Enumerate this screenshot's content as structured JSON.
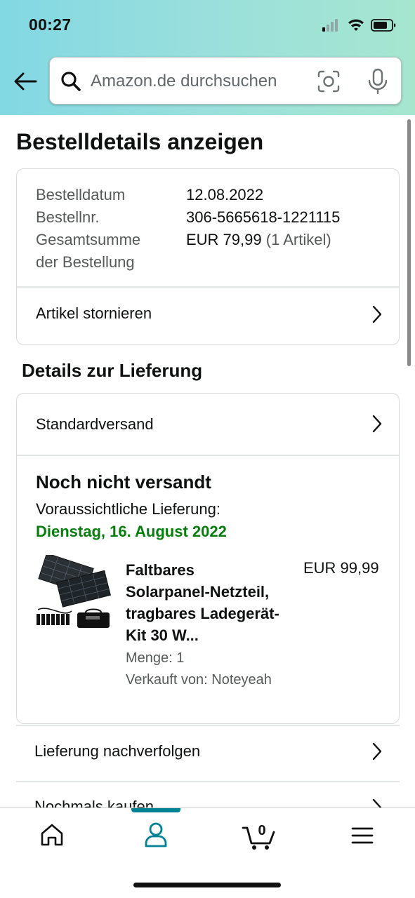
{
  "status_bar": {
    "time": "00:27"
  },
  "search": {
    "placeholder": "Amazon.de durchsuchen"
  },
  "page_title": "Bestelldetails anzeigen",
  "order": {
    "date_label": "Bestelldatum",
    "date_value": "12.08.2022",
    "number_label": "Bestellnr.",
    "number_value": "306-5665618-1221115",
    "total_label_line1": "Gesamtsumme",
    "total_label_line2": "der Bestellung",
    "total_value": "EUR 79,99",
    "total_items": "(1 Artikel)",
    "cancel_label": "Artikel stornieren"
  },
  "delivery": {
    "section_title": "Details zur Lieferung",
    "shipping_method": "Standardversand",
    "status": "Noch nicht versandt",
    "expected_label": "Voraussichtliche Lieferung:",
    "expected_date": "Dienstag, 16. August 2022",
    "product": {
      "title_lines": [
        "Faltbares",
        "Solarpanel-Netzteil,",
        "tragbares Ladegerät-",
        "Kit 30 W..."
      ],
      "price": "EUR 99,99",
      "quantity": "Menge: 1",
      "seller": "Verkauft von: Noteyeah"
    }
  },
  "actions": {
    "track": "Lieferung nachverfolgen",
    "buy_again": "Nochmals kaufen"
  },
  "tabbar": {
    "cart_count": "0",
    "active_tab": "account"
  },
  "colors": {
    "header_gradient_start": "#82d8e3",
    "header_gradient_end": "#a6e6cf",
    "delivery_green": "#067d0d",
    "active_tab_teal": "#008296"
  },
  "icons": [
    "back-arrow-icon",
    "search-icon",
    "camera-scan-icon",
    "microphone-icon",
    "chevron-right-icon",
    "home-icon",
    "account-icon",
    "cart-icon",
    "menu-icon"
  ]
}
